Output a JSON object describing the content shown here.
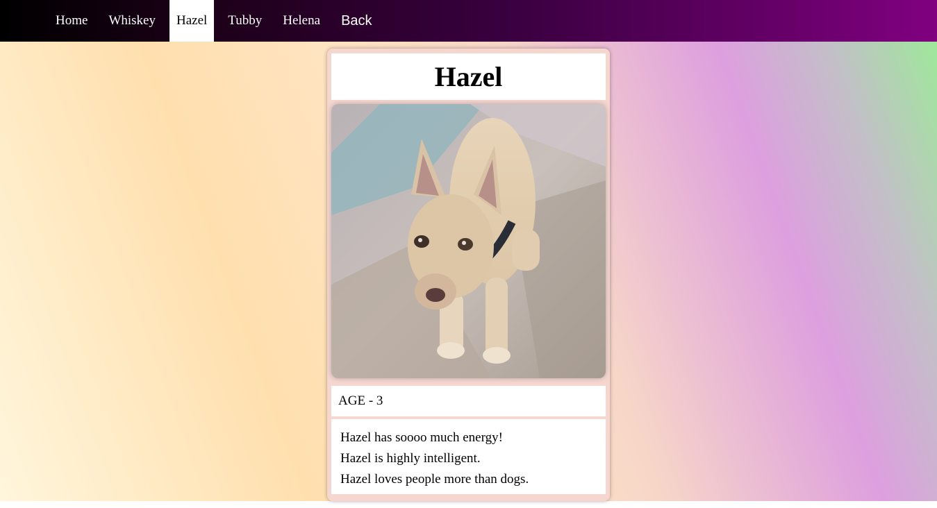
{
  "nav": {
    "items": [
      {
        "label": "Home"
      },
      {
        "label": "Whiskey"
      },
      {
        "label": "Hazel"
      },
      {
        "label": "Tubby"
      },
      {
        "label": "Helena"
      }
    ],
    "back_label": "Back",
    "active": "Hazel"
  },
  "dog": {
    "name": "Hazel",
    "age_label": "AGE",
    "age_separator": "-",
    "age_value": "3",
    "facts": [
      "Hazel has soooo much energy!",
      "Hazel is highly intelligent.",
      "Hazel loves people more than dogs."
    ]
  },
  "colors": {
    "nav_start": "#000000",
    "nav_end": "#800080",
    "card_border": "#f6d7d0"
  }
}
